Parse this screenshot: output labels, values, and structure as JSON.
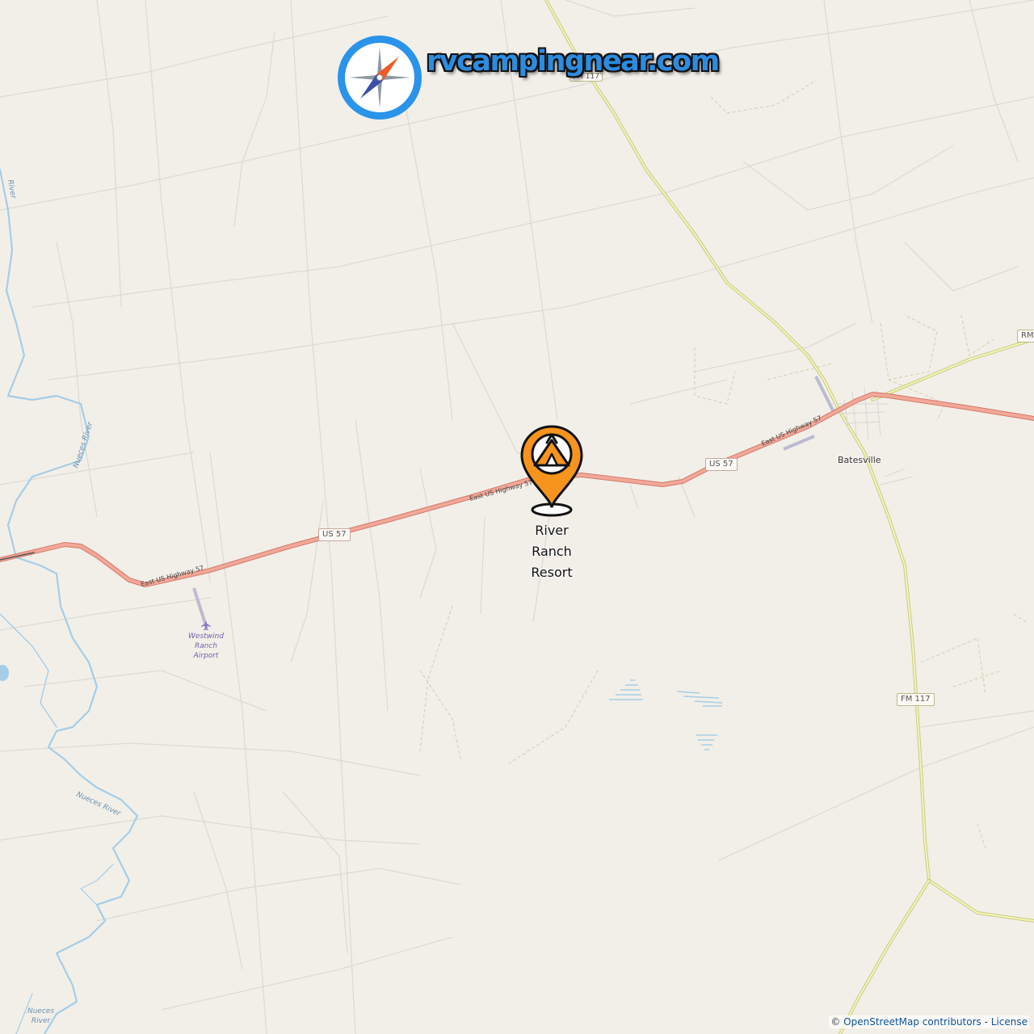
{
  "brand": {
    "text": "rvcampingnear.com",
    "icon": "compass-icon",
    "color": "#2b8ce0"
  },
  "poi": {
    "name": "River Ranch Resort",
    "lines": [
      "River",
      "Ranch",
      "Resort"
    ],
    "icon": "tent-pin-icon",
    "color": "#f7941d"
  },
  "roads": {
    "us57_shield": "US 57",
    "fm117_shield": "FM 117",
    "fm117_top_shield": "FM 117",
    "rm_shield": "RM",
    "highway_name": "East US Highway 57"
  },
  "places": {
    "town": "Batesville"
  },
  "water": {
    "river_a": "River",
    "river_b": "Nueces River",
    "river_c": "Nueces River",
    "river_d_lines": [
      "Nueces",
      "River"
    ]
  },
  "airport": {
    "lines": [
      "Westwind",
      "Ranch",
      "Airport"
    ]
  },
  "attribution": {
    "prefix": "© ",
    "osm": "OpenStreetMap contributors",
    "sep": " - ",
    "license": "License"
  },
  "colors": {
    "land": "#f2efe9",
    "highway": "#e89a8a",
    "secondary": "#dfe59a",
    "water": "#a6cde6",
    "track": "#dcdad4"
  }
}
